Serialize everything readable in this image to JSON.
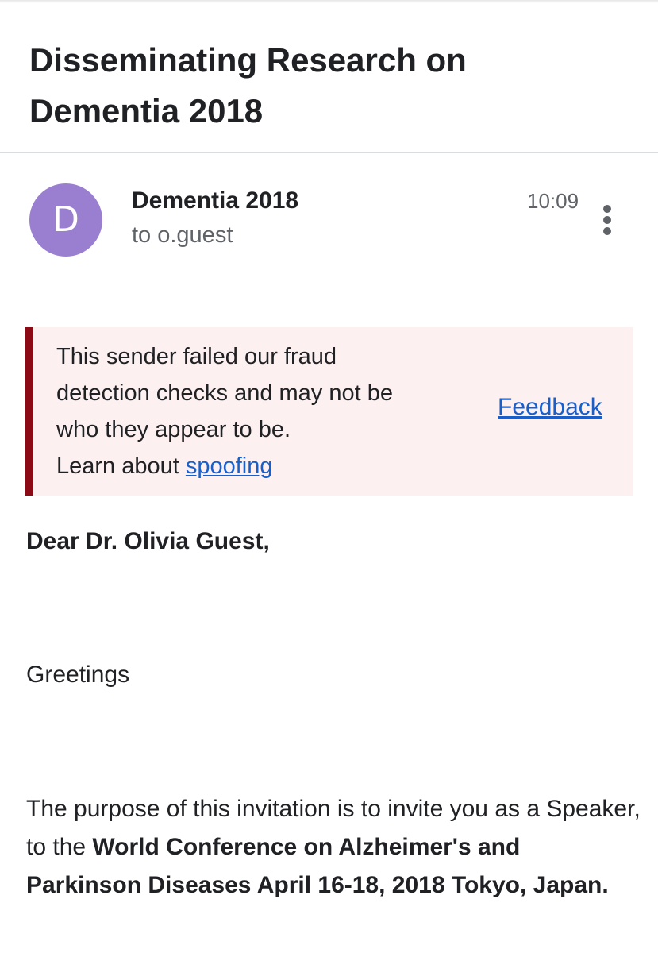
{
  "email": {
    "subject": "Disseminating Research on Dementia 2018",
    "sender": {
      "avatar_letter": "D",
      "avatar_color": "#9a7fd1",
      "name": "Dementia 2018",
      "recipient_line": "to o.guest",
      "time": "10:09"
    },
    "warning": {
      "message": "This sender failed our fraud detection checks and may not be who they appear to be.",
      "learn_prefix": "Learn about ",
      "spoofing_link": "spoofing",
      "feedback_link": "Feedback",
      "border_color": "#8c0a16",
      "background_color": "#fcf0f1"
    },
    "body": {
      "salutation": "Dear Dr. Olivia Guest,",
      "greeting": "Greetings",
      "paragraph_intro": "The purpose of this invitation is to invite you as a Speaker, to the ",
      "paragraph_bold": "World Conference on Alzheimer's and  Parkinson Diseases April 16-18, 2018 Tokyo, Japan."
    }
  },
  "icons": {
    "more_options": "more-vert-icon"
  },
  "colors": {
    "link": "#1a5fc8",
    "text_primary": "#202124",
    "text_secondary": "#5f6368"
  }
}
